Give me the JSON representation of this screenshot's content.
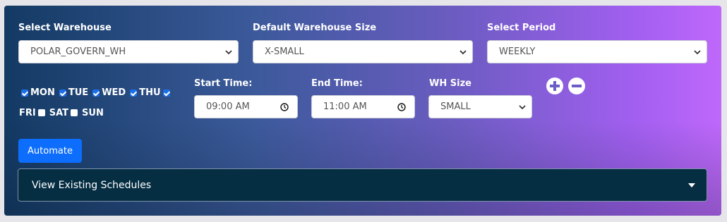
{
  "warehouse": {
    "label": "Select Warehouse",
    "value": "POLAR_GOVERN_WH"
  },
  "default_size": {
    "label": "Default Warehouse Size",
    "value": "X-SMALL"
  },
  "period": {
    "label": "Select Period",
    "value": "WEEKLY"
  },
  "days": [
    {
      "name": "MON",
      "checked": true
    },
    {
      "name": "TUE",
      "checked": true
    },
    {
      "name": "WED",
      "checked": true
    },
    {
      "name": "THU",
      "checked": true
    },
    {
      "name": "FRI",
      "checked": true
    },
    {
      "name": "SAT",
      "checked": false
    },
    {
      "name": "SUN",
      "checked": false
    }
  ],
  "start_time": {
    "label": "Start Time:",
    "value": "09:00 AM"
  },
  "end_time": {
    "label": "End Time:",
    "value": "11:00 AM"
  },
  "wh_size": {
    "label": "WH Size",
    "value": "SMALL"
  },
  "actions": {
    "automate_label": "Automate"
  },
  "schedules": {
    "label": "View Existing Schedules"
  },
  "colors": {
    "primary_button": "#0d6efd",
    "accordion_bg": "#052e43",
    "gradient_start": "#133a63",
    "gradient_end": "#bf68fb"
  }
}
